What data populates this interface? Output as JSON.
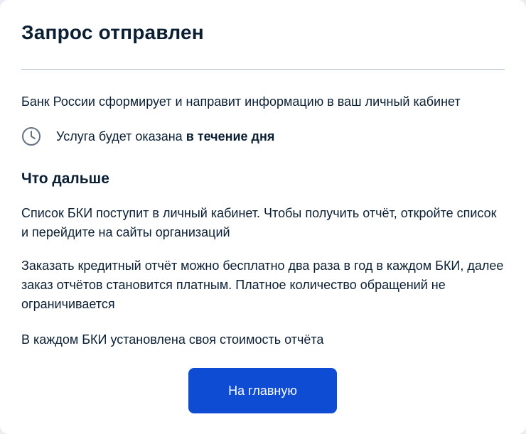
{
  "header": {
    "title": "Запрос отправлен"
  },
  "info": {
    "text": "Банк России сформирует и направит информацию в ваш личный кабинет"
  },
  "service": {
    "icon": "clock-icon",
    "text_prefix": "Услуга будет оказана ",
    "text_bold": "в течение дня"
  },
  "next": {
    "title": "Что дальше",
    "paragraphs": [
      "Список БКИ поступит в личный кабинет. Чтобы получить отчёт, откройте список и перейдите на сайты организаций",
      "Заказать кредитный отчёт можно бесплатно два раза в год в каждом БКИ, далее заказ отчётов становится платным. Платное количество обращений не ограничивается",
      "В каждом БКИ установлена своя стоимость отчёта"
    ]
  },
  "actions": {
    "home_label": "На главную"
  },
  "colors": {
    "primary_button": "#0d4cd3",
    "text": "#0b1f33",
    "icon": "#66727f",
    "divider": "#b3c0cf"
  }
}
